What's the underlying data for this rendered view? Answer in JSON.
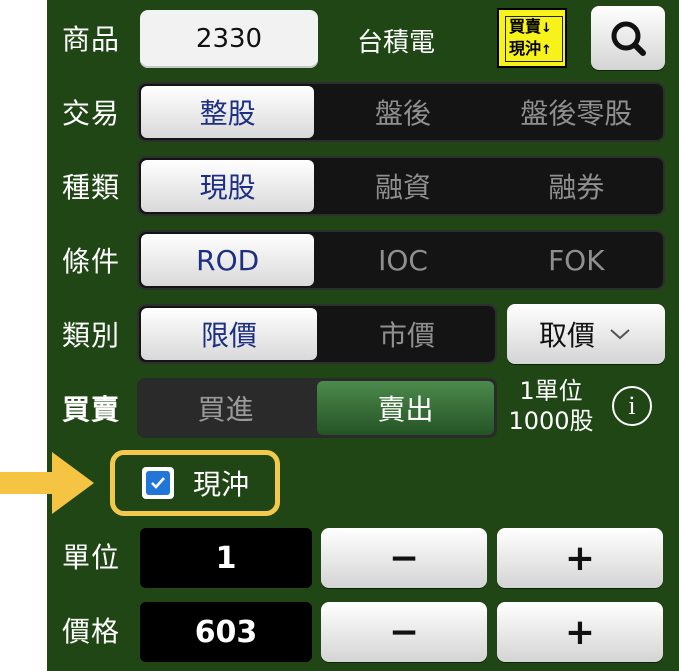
{
  "colors": {
    "panel_bg": "#1f4614",
    "active_text": "#1c2f82",
    "highlight": "#f2c94c",
    "sell_green": "#2f6a2f"
  },
  "product": {
    "label": "商品",
    "code": "2330",
    "name": "台積電",
    "switch_icon_text": "買賣\n現沖",
    "search_icon": "search-icon"
  },
  "trade": {
    "label": "交易",
    "options": [
      "整股",
      "盤後",
      "盤後零股"
    ],
    "selected": 0
  },
  "kind": {
    "label": "種類",
    "options": [
      "現股",
      "融資",
      "融券"
    ],
    "selected": 0
  },
  "condition": {
    "label": "條件",
    "options": [
      "ROD",
      "IOC",
      "FOK"
    ],
    "selected": 0
  },
  "category": {
    "label": "類別",
    "options": [
      "限價",
      "市價"
    ],
    "selected": 0,
    "fetch_price": "取價"
  },
  "side": {
    "label": "買賣",
    "options": [
      "買進",
      "賣出"
    ],
    "selected": 1,
    "unit_line1": "1單位",
    "unit_line2": "1000股"
  },
  "daytrade": {
    "label": "現沖",
    "checked": true
  },
  "quantity": {
    "label": "單位",
    "value": "1",
    "minus": "−",
    "plus": "+"
  },
  "price": {
    "label": "價格",
    "value": "603",
    "minus": "−",
    "plus": "+"
  }
}
